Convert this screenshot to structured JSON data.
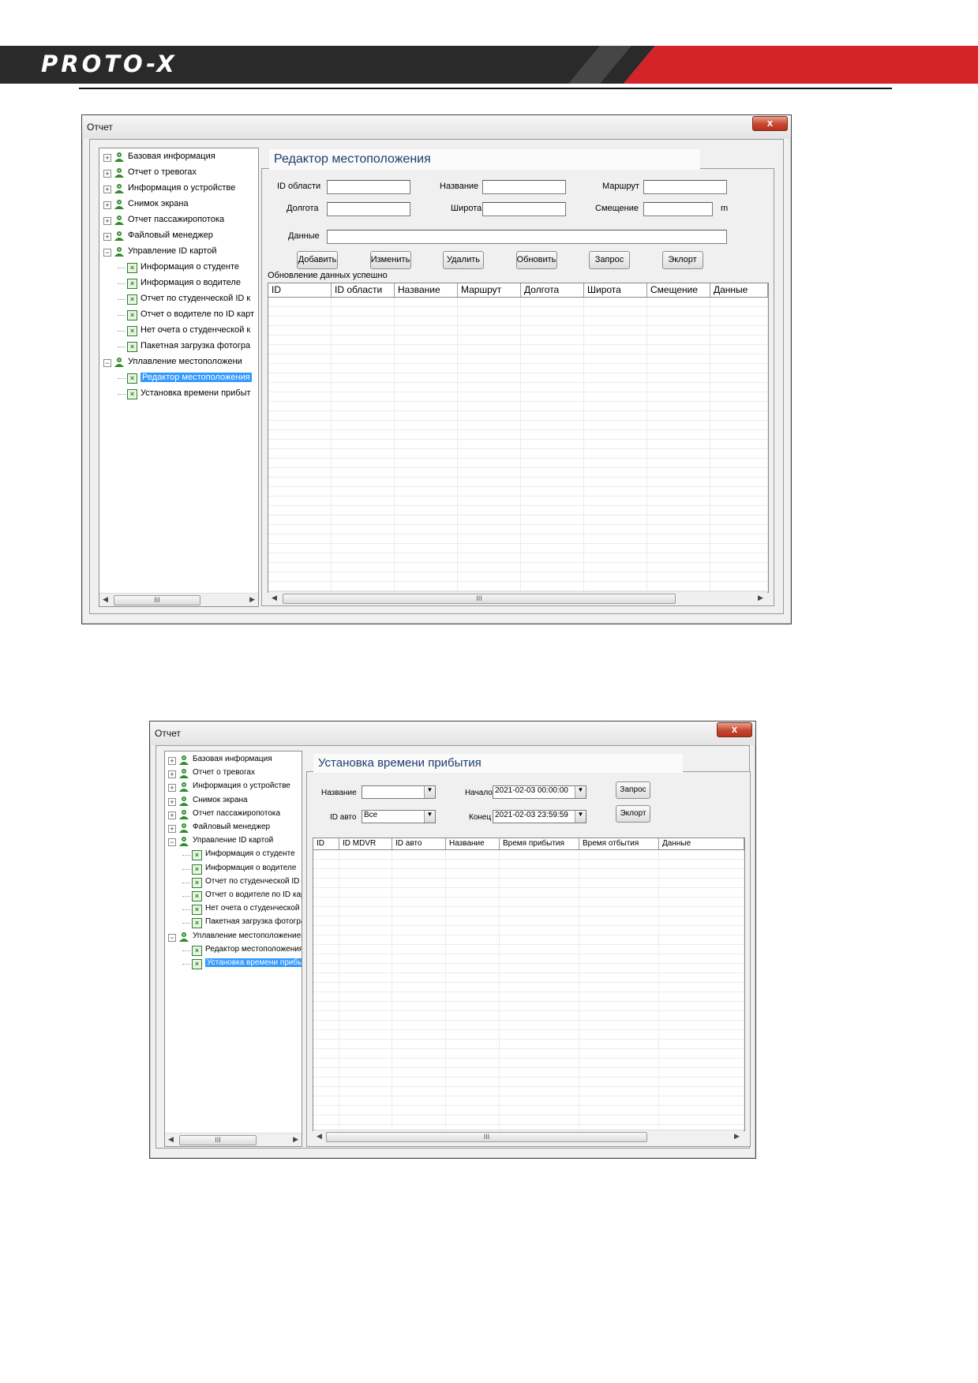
{
  "header": {
    "logo": "PROTO-X"
  },
  "window1": {
    "title": "Отчет",
    "close": "x",
    "tree": [
      {
        "label": "Базовая информация",
        "type": "group",
        "expand": "+"
      },
      {
        "label": "Отчет о тревогах",
        "type": "group",
        "expand": "+"
      },
      {
        "label": "Информация о устройстве",
        "type": "group",
        "expand": "+"
      },
      {
        "label": "Снимок экрана",
        "type": "group",
        "expand": "+"
      },
      {
        "label": "Отчет пассажиропотока",
        "type": "group",
        "expand": "+"
      },
      {
        "label": "Файловый менеджер",
        "type": "group",
        "expand": "+"
      },
      {
        "label": "Управление ID картой",
        "type": "group",
        "expand": "−"
      },
      {
        "label": "Информация о студенте",
        "type": "report"
      },
      {
        "label": "Информация о водителе",
        "type": "report"
      },
      {
        "label": "Отчет по студенческой ID к",
        "type": "report"
      },
      {
        "label": "Отчет о водителе по ID карт",
        "type": "report"
      },
      {
        "label": "Нет очета о студенческой к",
        "type": "report"
      },
      {
        "label": "Пакетная загрузка фотогра",
        "type": "report"
      },
      {
        "label": "Уплавление местоположени",
        "type": "group",
        "expand": "−"
      },
      {
        "label": "Редактор местоположения",
        "type": "report",
        "selected": true
      },
      {
        "label": "Установка времени прибыт",
        "type": "report"
      }
    ],
    "scroll_thumb": "III",
    "panel_title": "Редактор местоположения",
    "form": {
      "area_id_label": "ID области",
      "name_label": "Название",
      "route_label": "Маршрут",
      "lon_label": "Долгота",
      "lat_label": "Широта",
      "offset_label": "Смещение",
      "offset_unit": "m",
      "data_label": "Данные"
    },
    "buttons": [
      "Добавить",
      "Изменить",
      "Удалить",
      "Обновить",
      "Запрос",
      "Эклорт"
    ],
    "status": "Обновление данных успешно",
    "columns": [
      "ID",
      "ID области",
      "Название",
      "Маршрут",
      "Долгота",
      "Широта",
      "Смещение",
      "Данные"
    ],
    "grid_scroll_thumb": "III"
  },
  "window2": {
    "title": "Отчет",
    "close": "x",
    "tree": [
      {
        "label": "Базовая информация",
        "type": "group",
        "expand": "+"
      },
      {
        "label": "Отчет о тревогах",
        "type": "group",
        "expand": "+"
      },
      {
        "label": "Информация о устройстве",
        "type": "group",
        "expand": "+"
      },
      {
        "label": "Снимок экрана",
        "type": "group",
        "expand": "+"
      },
      {
        "label": "Отчет пассажиропотока",
        "type": "group",
        "expand": "+"
      },
      {
        "label": "Файловый менеджер",
        "type": "group",
        "expand": "+"
      },
      {
        "label": "Управление ID картой",
        "type": "group",
        "expand": "−"
      },
      {
        "label": "Информация о студенте",
        "type": "report"
      },
      {
        "label": "Информация о водителе",
        "type": "report"
      },
      {
        "label": "Отчет по студенческой ID к",
        "type": "report"
      },
      {
        "label": "Отчет о водителе по ID карт",
        "type": "report"
      },
      {
        "label": "Нет очета о студенческой к",
        "type": "report"
      },
      {
        "label": "Пакетная загрузка фотогра",
        "type": "report"
      },
      {
        "label": "Уплавление местоположением",
        "type": "group",
        "expand": "−"
      },
      {
        "label": "Редактор местоположения",
        "type": "report"
      },
      {
        "label": "Установка времени прибыт",
        "type": "report",
        "selected": true
      }
    ],
    "scroll_thumb": "III",
    "panel_title": "Установка времени прибытия",
    "form": {
      "name_label": "Название",
      "name_value": "",
      "car_id_label": "ID авто",
      "car_id_value": "Все",
      "start_label": "Начало",
      "start_value": "2021-02-03 00:00:00",
      "end_label": "Конец",
      "end_value": "2021-02-03 23:59:59"
    },
    "buttons": [
      "Запрос",
      "Эклорт"
    ],
    "columns": [
      "ID",
      "ID MDVR",
      "ID авто",
      "Название",
      "Время прибытия",
      "Время отбытия",
      "Данные"
    ],
    "grid_scroll_thumb": "III"
  }
}
